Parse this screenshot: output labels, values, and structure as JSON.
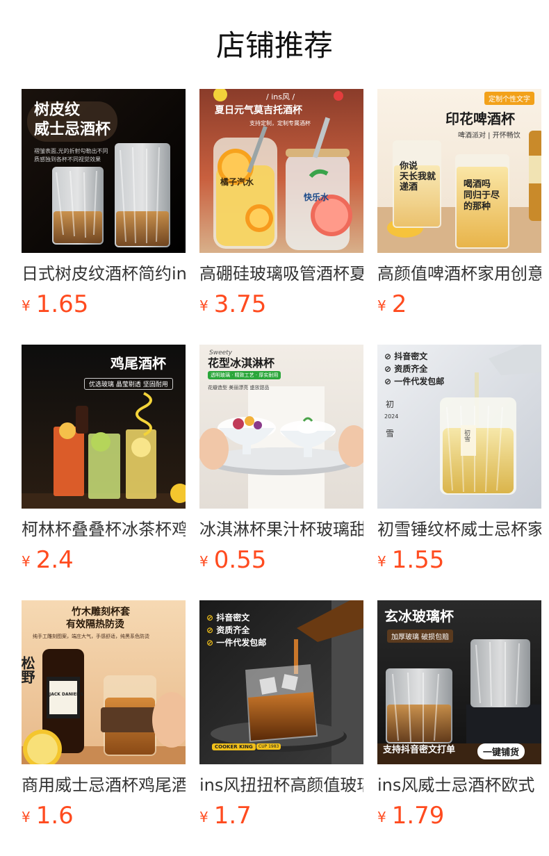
{
  "page": {
    "title": "店铺推荐"
  },
  "currency_symbol": "¥",
  "products": [
    {
      "name": "日式树皮纹酒杯简约ins",
      "price": "1.65",
      "image": {
        "title": "树皮纹\n威士忌酒杯",
        "lines": [
          "树皮纹",
          "威士忌酒杯"
        ],
        "caption": "褶皱表面,光的折射勾勒出不同\n质感独到各杯不同视觉效果"
      }
    },
    {
      "name": "高硼硅玻璃吸管酒杯夏日",
      "price": "3.75",
      "image": {
        "tag": "/ ins风 /",
        "title": "夏日元气莫吉托酒杯",
        "subtitle": "支持定制，定制专属酒杯",
        "cup_text_1": "橘子汽水",
        "cup_text_2": "快乐水"
      }
    },
    {
      "name": "高颜值啤酒杯家用创意",
      "price": "2",
      "image": {
        "badge": "定制个性文字",
        "title": "印花啤酒杯",
        "subtitle": "啤酒派对 | 开怀畅饮",
        "cup_text_1": "你说\n天长我就\n递酒",
        "cup_text_2": "喝酒吗\n同归于尽\n的那种"
      }
    },
    {
      "name": "柯林杯叠叠杯冰茶杯鸡尾",
      "price": "2.4",
      "image": {
        "title": "鸡尾酒杯",
        "subtitle": "优选玻璃 晶莹剔透 坚固耐用"
      }
    },
    {
      "name": "冰淇淋杯果汁杯玻璃甜品",
      "price": "0.55",
      "image": {
        "script": "Sweety",
        "title": "花型冰淇淋杯",
        "subtitle": "透明玻璃 · 精致工艺 · 厚实耐用",
        "caption": "花瓣造型 美丽漂亮 盛放甜品"
      }
    },
    {
      "name": "初雪锤纹杯威士忌杯家用",
      "price": "1.55",
      "image": {
        "checks": [
          "抖音密文",
          "资质齐全",
          "一件代发包邮"
        ],
        "side_text": "初",
        "year": "2024",
        "side_text_2": "雪",
        "cup_label": "初雪"
      }
    },
    {
      "name": "商用威士忌酒杯鸡尾酒杯",
      "price": "1.6",
      "image": {
        "title": "竹木雕刻杯套\n有效隔热防烫",
        "lines": [
          "竹木雕刻杯套",
          "有效隔热防烫"
        ],
        "caption": "纯手工雕刻图案，端庄大气，手感舒适，纯黑系色防烫",
        "bottle_label": "JACK DANIEL'S",
        "side_text": "松野"
      }
    },
    {
      "name": "ins风扭扭杯高颜值玻璃",
      "price": "1.7",
      "image": {
        "checks": [
          "抖音密文",
          "资质齐全",
          "一件代发包邮"
        ],
        "brand": "COOKER KING",
        "sub_brand": "CUP 1983"
      }
    },
    {
      "name": "ins风威士忌酒杯欧式",
      "price": "1.79",
      "image": {
        "title": "玄冰玻璃杯",
        "subtitle": "加厚玻璃 破损包赔",
        "banner_left": "支持抖音密文打单",
        "banner_right": "一键铺货"
      }
    }
  ],
  "colors": {
    "price": "#ff4b1f",
    "title": "#111111",
    "name": "#333333"
  }
}
